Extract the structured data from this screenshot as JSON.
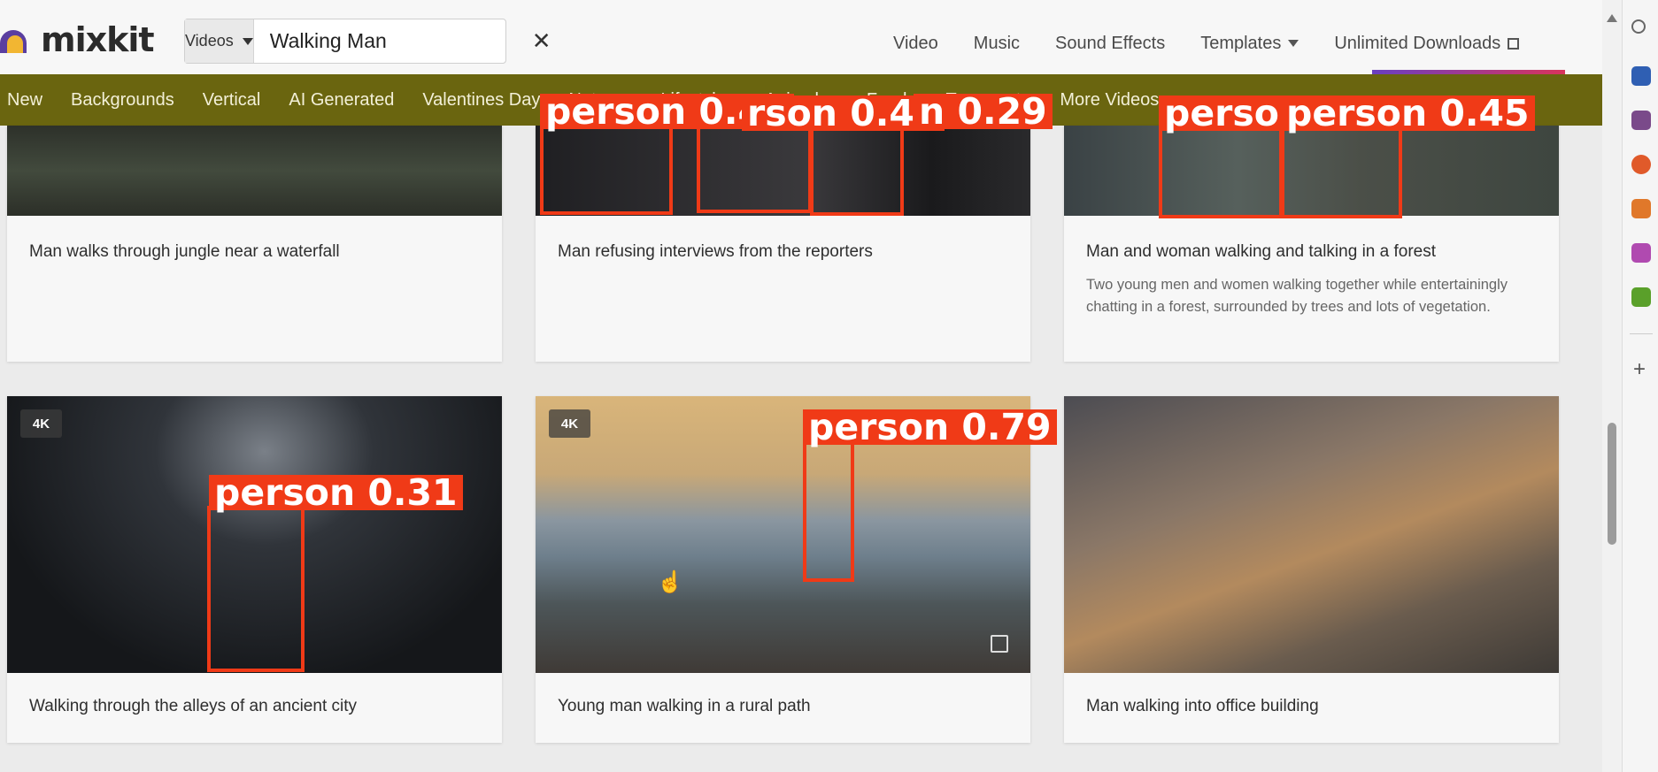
{
  "header": {
    "logo_text": "mixkit",
    "search": {
      "type": "Videos",
      "value": "Walking Man"
    },
    "nav": [
      "Video",
      "Music",
      "Sound Effects",
      "Templates",
      "Unlimited Downloads"
    ]
  },
  "categories": [
    "New",
    "Backgrounds",
    "Vertical",
    "AI Generated",
    "Valentines Day",
    "Nature",
    "Lifestyle",
    "Animals",
    "Food",
    "Transport",
    "More Videos"
  ],
  "cards": [
    {
      "title": "Man walks through jungle near a waterfall",
      "desc": ""
    },
    {
      "title": "Man refusing interviews from the reporters",
      "desc": ""
    },
    {
      "title": "Man and woman walking and talking in a forest",
      "desc": "Two young men and women walking together while entertainingly chatting in a forest, surrounded by trees and lots of vegetation."
    },
    {
      "title": "Walking through the alleys of an ancient city",
      "badge": "4K"
    },
    {
      "title": "Young man walking in a rural path",
      "badge": "4K"
    },
    {
      "title": "Man walking into office building"
    }
  ],
  "detections": {
    "d1": "person  0.48",
    "d2": "rson  0.45",
    "d3": "n 0.29",
    "d4": "person",
    "d5": "person  0.45",
    "d6": "person  0.31",
    "d7": "person  0.79"
  },
  "colors": {
    "accent": "#f03a17",
    "category_bar": "#6a650f"
  }
}
